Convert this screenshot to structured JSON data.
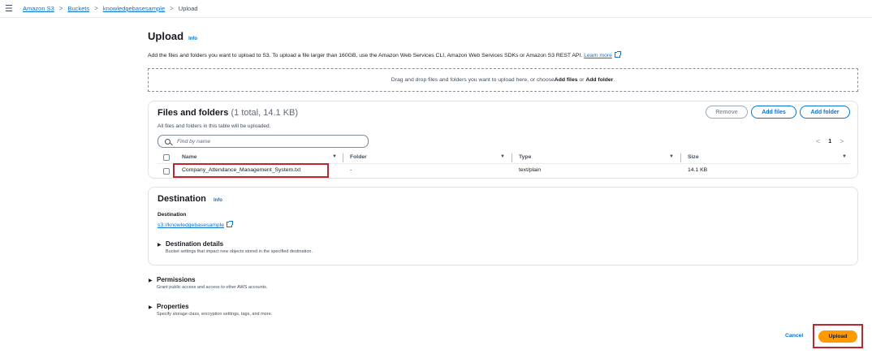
{
  "breadcrumb": {
    "items": [
      "Amazon S3",
      "Buckets",
      "knowledgebasesample"
    ],
    "current": "Upload",
    "separator": ">"
  },
  "page": {
    "title": "Upload",
    "info": "Info",
    "description": "Add the files and folders you want to upload to S3. To upload a file larger than 160GB, use the Amazon Web Services CLI, Amazon Web Services SDKs or Amazon S3 REST API.",
    "learn_more": "Learn more"
  },
  "dropzone": {
    "text_before": "Drag and drop files and folders you want to upload here, or choose ",
    "add_files": "Add files",
    "or": " or ",
    "add_folder": "Add folder",
    "end": "."
  },
  "files_panel": {
    "title": "Files and folders",
    "count": "(1 total, 14.1 KB)",
    "subtitle": "All files and folders in this table will be uploaded.",
    "remove_button": "Remove",
    "add_files_button": "Add files",
    "add_folder_button": "Add folder",
    "search_placeholder": "Find by name",
    "pager": {
      "prev": "<",
      "page": "1",
      "next": ">"
    },
    "columns": [
      "Name",
      "Folder",
      "Type",
      "Size"
    ],
    "rows": [
      {
        "name": "Company_Attendance_Management_System.txt",
        "folder": "-",
        "type": "text/plain",
        "size": "14.1 KB"
      }
    ]
  },
  "destination_panel": {
    "title": "Destination",
    "info": "Info",
    "label": "Destination",
    "link": "s3://knowledgebasesample",
    "details_title": "Destination details",
    "details_desc": "Bucket settings that impact new objects stored in the specified destination."
  },
  "permissions": {
    "title": "Permissions",
    "desc": "Grant public access and access to other AWS accounts."
  },
  "properties": {
    "title": "Properties",
    "desc": "Specify storage class, encryption settings, tags, and more."
  },
  "footer": {
    "cancel": "Cancel",
    "upload": "Upload"
  },
  "colors": {
    "link": "#0972d3",
    "primary_button": "#ff9900",
    "highlight": "#c0272d"
  }
}
